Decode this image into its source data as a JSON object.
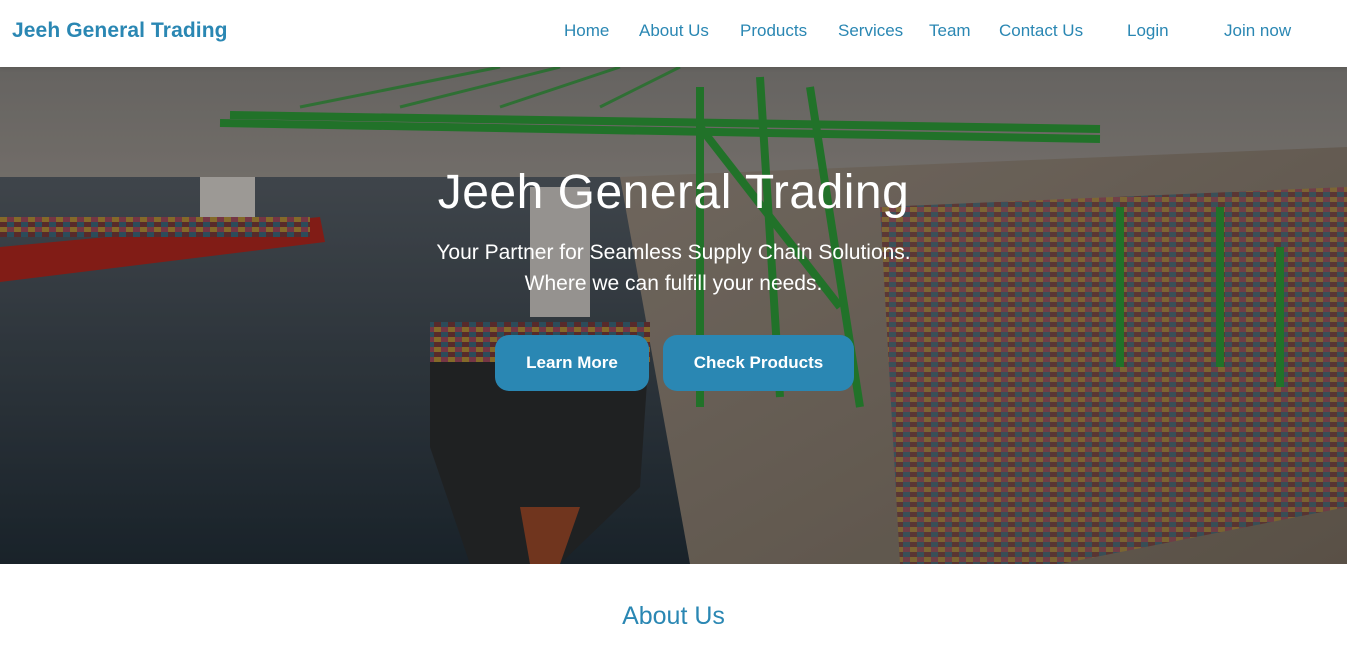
{
  "brand": "Jeeh General Trading",
  "nav": {
    "home": "Home",
    "about": "About Us",
    "products": "Products",
    "services": "Services",
    "team": "Team",
    "contact": "Contact Us",
    "login": "Login",
    "join": "Join now"
  },
  "hero": {
    "title": "Jeeh General Trading",
    "subtitle_1": "Your Partner for Seamless Supply Chain Solutions.",
    "subtitle_2": "Where we can fulfill your needs.",
    "learn_more": "Learn More",
    "check_products": "Check Products"
  },
  "about_heading": "About Us",
  "colors": {
    "accent": "#2a87b3"
  }
}
